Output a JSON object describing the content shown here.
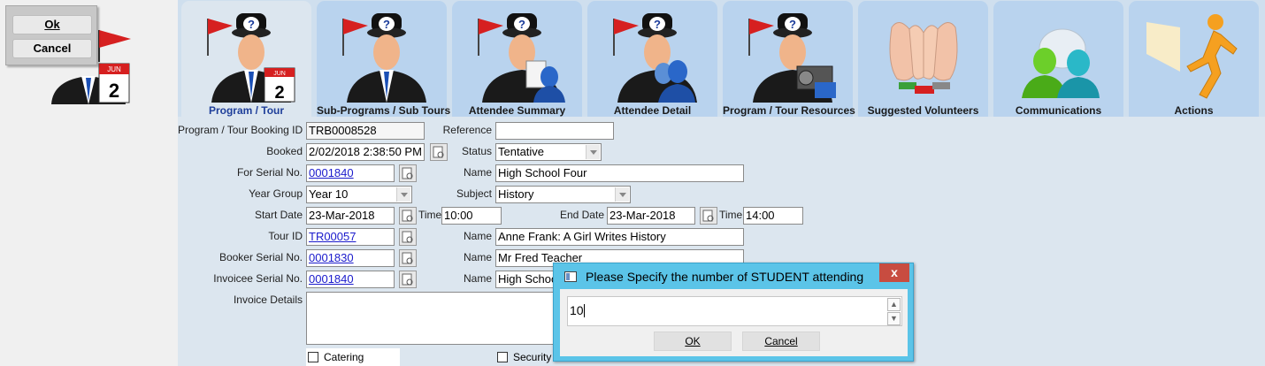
{
  "left_panel": {
    "ok_label": "Ok",
    "cancel_label": "Cancel",
    "figure_icon": "program-tour-person-calendar-icon",
    "calendar_month": "JUN",
    "calendar_day": "2"
  },
  "tabs": [
    {
      "label": "Program / Tour",
      "icon": "program-tour-icon",
      "active": true
    },
    {
      "label": "Sub-Programs / Sub Tours",
      "icon": "sub-programs-icon",
      "active": false
    },
    {
      "label": "Attendee Summary",
      "icon": "attendee-summary-icon",
      "active": false
    },
    {
      "label": "Attendee Detail",
      "icon": "attendee-detail-icon",
      "active": false
    },
    {
      "label": "Program / Tour Resources",
      "icon": "resources-icon",
      "active": false
    },
    {
      "label": "Suggested Volunteers",
      "icon": "volunteers-hands-icon",
      "active": false
    },
    {
      "label": "Communications",
      "icon": "communications-people-icon",
      "active": false
    },
    {
      "label": "Actions",
      "icon": "running-man-icon",
      "active": false
    }
  ],
  "form": {
    "booking_id_label": "Program / Tour Booking ID",
    "booking_id": "TRB0008528",
    "reference_label": "Reference",
    "reference": "",
    "booked_label": "Booked",
    "booked": "2/02/2018 2:38:50 PM",
    "status_label": "Status",
    "status": "Tentative",
    "for_serial_label": "For Serial No.",
    "for_serial": "0001840",
    "name_label": "Name",
    "for_name": "High School Four",
    "year_group_label": "Year Group",
    "year_group": "Year 10",
    "subject_label": "Subject",
    "subject": "History",
    "start_date_label": "Start Date",
    "start_date": "23-Mar-2018",
    "time_label": "Time",
    "start_time": "10:00",
    "end_date_label": "End Date",
    "end_date": "23-Mar-2018",
    "end_time": "14:00",
    "tour_id_label": "Tour ID",
    "tour_id": "TR00057",
    "tour_name": "Anne Frank: A Girl Writes History",
    "booker_serial_label": "Booker Serial No.",
    "booker_serial": "0001830",
    "booker_name": "Mr Fred Teacher",
    "invoicee_serial_label": "Invoicee Serial No.",
    "invoicee_serial": "0001840",
    "invoicee_name": "High School Four",
    "invoice_details_label": "Invoice Details",
    "invoice_details": "",
    "catering_label": "Catering",
    "security_label": "Security"
  },
  "dialog": {
    "title": "Please Specify the number of STUDENT attending",
    "close_label": "x",
    "value": "10",
    "ok_label": "OK",
    "cancel_label": "Cancel"
  }
}
